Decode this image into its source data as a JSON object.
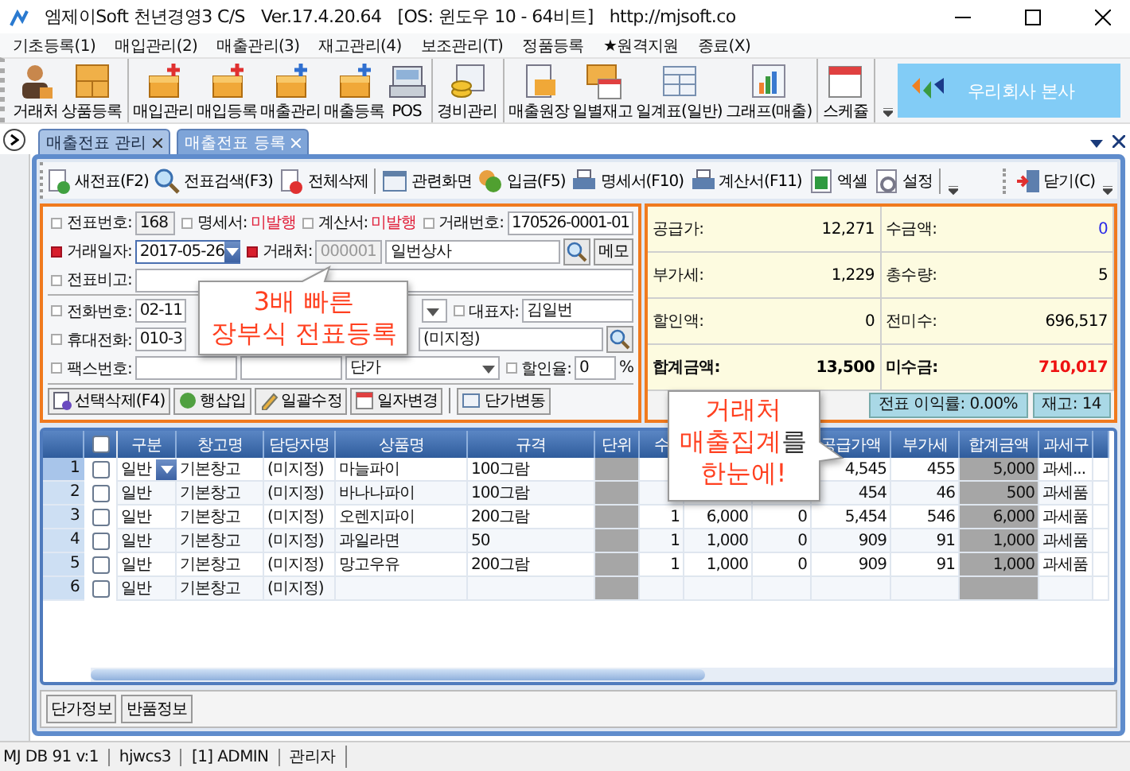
{
  "window": {
    "title": "엠제이Soft 천년경영3 C/S",
    "version": "Ver.17.4.20.64",
    "os": "[OS: 윈도우 10 - 64비트]",
    "url": "http://mjsoft.co"
  },
  "menu": [
    "기초등록(1)",
    "매입관리(2)",
    "매출관리(3)",
    "재고관리(4)",
    "보조관리(T)",
    "정품등록",
    "★원격지원",
    "종료(X)"
  ],
  "main_toolbar": {
    "groups": [
      [
        "거래처",
        "상품등록"
      ],
      [
        "매입관리",
        "매입등록",
        "매출관리",
        "매출등록",
        "POS"
      ],
      [
        "경비관리"
      ],
      [
        "매출원장",
        "일별재고",
        "일계표(일반)",
        "그래프(매출)"
      ],
      [
        "스케쥴"
      ]
    ],
    "banner": "우리회사 본사"
  },
  "tabs": [
    {
      "label": "매출전표 관리",
      "selected": false
    },
    {
      "label": "매출전표 등록",
      "selected": true
    }
  ],
  "doc_toolbar": {
    "groups": [
      [
        "새전표(F2)",
        "전표검색(F3)",
        "전체삭제"
      ],
      [
        "관련화면",
        "입금(F5)",
        "명세서(F10)",
        "계산서(F11)",
        "엑셀",
        "설정"
      ]
    ],
    "close": "닫기(C)"
  },
  "form": {
    "slip_no": {
      "label": "전표번호:",
      "value": "168",
      "required": false
    },
    "statement": {
      "label": "명세서:",
      "value": "미발행",
      "required": false
    },
    "invoice": {
      "label": "계산서:",
      "value": "미발행",
      "required": false
    },
    "trade_no": {
      "label": "거래번호:",
      "value": "170526-0001-01",
      "required": false
    },
    "trade_date": {
      "label": "거래일자:",
      "value": "2017-05-26",
      "required": true
    },
    "customer": {
      "label": "거래처:",
      "code": "000001",
      "value": "일번상사",
      "required": true
    },
    "memo_button": "메모",
    "note": {
      "label": "전표비고:",
      "required": false
    },
    "phone": {
      "label": "전화번호:",
      "value": "02-11",
      "required": false
    },
    "ceo": {
      "label": "대표자:",
      "value": "김일번",
      "required": false
    },
    "mobile": {
      "label": "휴대전화:",
      "value": "010-3",
      "required": false
    },
    "manager": {
      "value": "(미지정)"
    },
    "fax": {
      "label": "팩스번호:",
      "required": false
    },
    "price_type": {
      "value": "단가"
    },
    "discount": {
      "label": "할인율:",
      "value": "0",
      "unit": "%",
      "required": false
    },
    "actions": [
      [
        "선택삭제(F4)",
        "행삽입",
        "일괄수정",
        "일자변경"
      ],
      [
        "단가변동"
      ]
    ]
  },
  "summary": {
    "fields": [
      {
        "label": "공급가:",
        "value": "12,271",
        "bold": false,
        "color": "#000000"
      },
      {
        "label": "수금액:",
        "value": "0",
        "bold": false,
        "color": "#2a2ae8"
      },
      {
        "label": "부가세:",
        "value": "1,229",
        "bold": false,
        "color": "#000000"
      },
      {
        "label": "총수량:",
        "value": "5",
        "bold": false,
        "color": "#000000"
      },
      {
        "label": "할인액:",
        "value": "0",
        "bold": false,
        "color": "#000000"
      },
      {
        "label": "전미수:",
        "value": "696,517",
        "bold": false,
        "color": "#000000"
      },
      {
        "label": "합계금액:",
        "value": "13,500",
        "bold": true,
        "color": "#000000"
      },
      {
        "label": "미수금:",
        "value": "710,017",
        "bold": true,
        "color": "#ee1111"
      }
    ],
    "footer": [
      "전표 이익률: 0.00%",
      "재고: 14"
    ]
  },
  "grid": {
    "header_checked": false,
    "columns": [
      "구분",
      "창고명",
      "담당자명",
      "상품명",
      "규격",
      "단위",
      "수",
      null,
      null,
      "공급가액",
      "부가세",
      "합계금액",
      "과세구"
    ],
    "rows": [
      {
        "no": "1",
        "checked": false,
        "editing": true,
        "cells": [
          "일반",
          "기본창고",
          "(미지정)",
          "마늘파이",
          "100그람",
          null,
          null,
          null,
          null,
          "4,545",
          "455",
          "5,000",
          "과세..."
        ]
      },
      {
        "no": "2",
        "checked": false,
        "editing": false,
        "cells": [
          "일반",
          "기본창고",
          "(미지정)",
          "바나나파이",
          "100그람",
          null,
          null,
          null,
          null,
          "454",
          "46",
          "500",
          "과세품"
        ]
      },
      {
        "no": "3",
        "checked": false,
        "editing": false,
        "cells": [
          "일반",
          "기본창고",
          "(미지정)",
          "오렌지파이",
          "200그람",
          null,
          "1",
          "6,000",
          "0",
          "5,454",
          "546",
          "6,000",
          "과세품"
        ]
      },
      {
        "no": "4",
        "checked": false,
        "editing": false,
        "cells": [
          "일반",
          "기본창고",
          "(미지정)",
          "과일라면",
          "50",
          null,
          "1",
          "1,000",
          "0",
          "909",
          "91",
          "1,000",
          "과세품"
        ]
      },
      {
        "no": "5",
        "checked": false,
        "editing": false,
        "cells": [
          "일반",
          "기본창고",
          "(미지정)",
          "망고우유",
          "200그람",
          null,
          "1",
          "1,000",
          "0",
          "909",
          "91",
          "1,000",
          "과세품"
        ]
      },
      {
        "no": "6",
        "checked": false,
        "editing": false,
        "cells": [
          "일반",
          "기본창고",
          "(미지정)",
          null,
          null,
          null,
          null,
          null,
          null,
          null,
          null,
          null,
          null
        ]
      }
    ]
  },
  "bottom_tabs": [
    "단가정보",
    "반품정보"
  ],
  "status_bar": [
    "MJ DB 91 v:1",
    "hjwcs3",
    "[1] ADMIN",
    "관리자"
  ],
  "callouts": [
    {
      "lines": [
        [
          {
            "text": "3배 빠른",
            "accent": true
          }
        ],
        [
          {
            "text": "장부식 전표등록",
            "accent": true
          }
        ]
      ]
    },
    {
      "lines": [
        [
          {
            "text": "거래처",
            "accent": true
          }
        ],
        [
          {
            "text": "매출집계",
            "accent": true
          },
          {
            "text": "를",
            "accent": false
          }
        ],
        [
          {
            "text": "한눈에!",
            "accent": true
          }
        ]
      ]
    }
  ]
}
